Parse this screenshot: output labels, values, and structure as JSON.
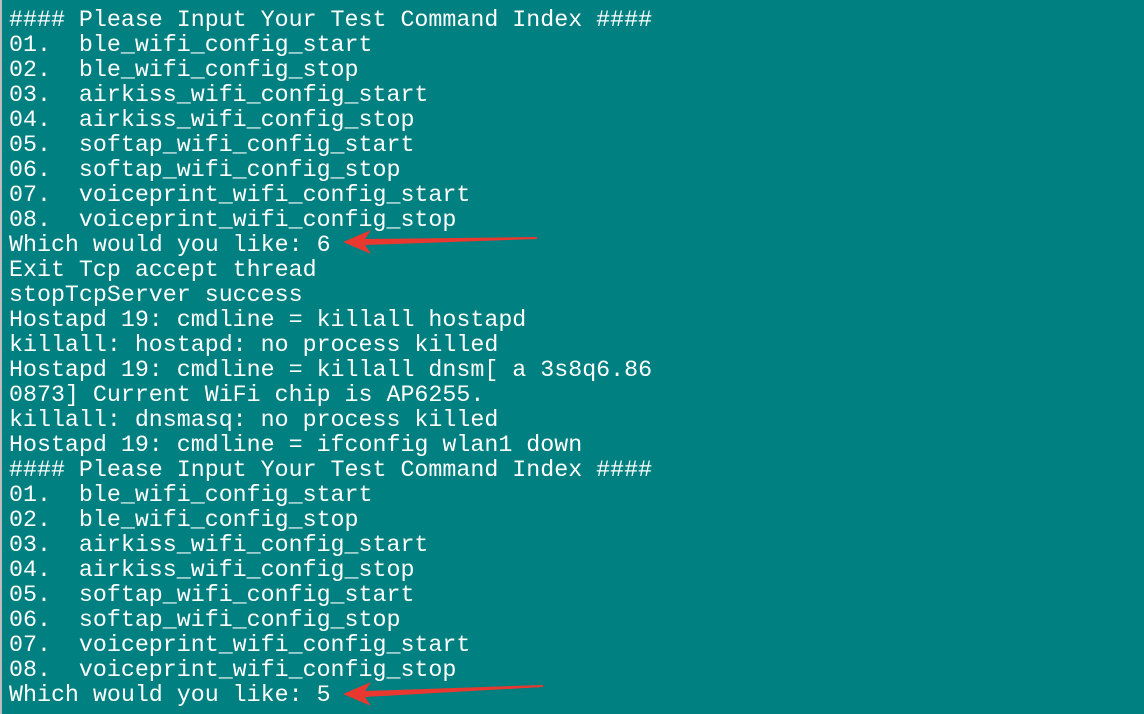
{
  "terminal": {
    "background": "#008080",
    "text_color": "#ffffff",
    "lines": [
      "#### Please Input Your Test Command Index ####",
      "01.  ble_wifi_config_start",
      "02.  ble_wifi_config_stop",
      "03.  airkiss_wifi_config_start",
      "04.  airkiss_wifi_config_stop",
      "05.  softap_wifi_config_start",
      "06.  softap_wifi_config_stop",
      "07.  voiceprint_wifi_config_start",
      "08.  voiceprint_wifi_config_stop",
      "Which would you like: 6",
      "Exit Tcp accept thread",
      "stopTcpServer success",
      "Hostapd 19: cmdline = killall hostapd",
      "killall: hostapd: no process killed",
      "Hostapd 19: cmdline = killall dnsm[ a 3s8q6.86",
      "0873] Current WiFi chip is AP6255.",
      "killall: dnsmasq: no process killed",
      "Hostapd 19: cmdline = ifconfig wlan1 down",
      "#### Please Input Your Test Command Index ####",
      "01.  ble_wifi_config_start",
      "02.  ble_wifi_config_stop",
      "03.  airkiss_wifi_config_start",
      "04.  airkiss_wifi_config_stop",
      "05.  softap_wifi_config_start",
      "06.  softap_wifi_config_stop",
      "07.  voiceprint_wifi_config_start",
      "08.  voiceprint_wifi_config_stop",
      "Which would you like: 5"
    ]
  },
  "annotations": {
    "arrow_color": "#e8382f",
    "arrows": [
      "red-arrow-pointing-left",
      "red-arrow-pointing-left"
    ]
  }
}
